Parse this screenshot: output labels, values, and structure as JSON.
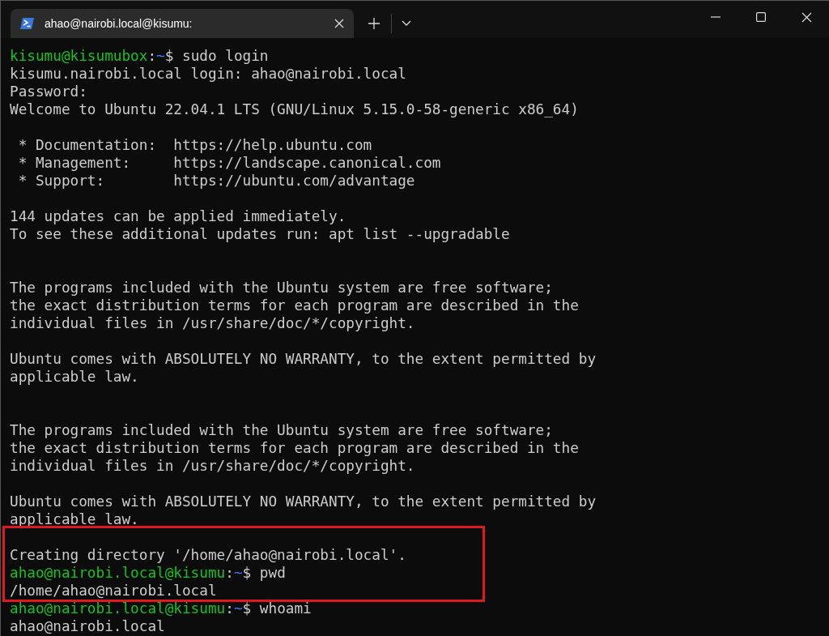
{
  "window": {
    "tab": {
      "title": "ahao@nairobi.local@kisumu:",
      "selected": true
    }
  },
  "blocks": [
    {
      "highlighted": false,
      "lines": [
        {
          "kind": "prompt",
          "user_host": "kisumu@kisumubox",
          "separator": ":",
          "path": "~",
          "command": "$ sudo login"
        },
        {
          "kind": "output",
          "text": "kisumu.nairobi.local login: ahao@nairobi.local"
        },
        {
          "kind": "output",
          "text": "Password:"
        },
        {
          "kind": "output",
          "text": "Welcome to Ubuntu 22.04.1 LTS (GNU/Linux 5.15.0-58-generic x86_64)"
        },
        {
          "kind": "blank"
        },
        {
          "kind": "output",
          "text": " * Documentation:  https://help.ubuntu.com"
        },
        {
          "kind": "output",
          "text": " * Management:     https://landscape.canonical.com"
        },
        {
          "kind": "output",
          "text": " * Support:        https://ubuntu.com/advantage"
        },
        {
          "kind": "blank"
        },
        {
          "kind": "output",
          "text": "144 updates can be applied immediately."
        },
        {
          "kind": "output",
          "text": "To see these additional updates run: apt list --upgradable"
        },
        {
          "kind": "blank"
        },
        {
          "kind": "blank"
        },
        {
          "kind": "output",
          "text": "The programs included with the Ubuntu system are free software;"
        },
        {
          "kind": "output",
          "text": "the exact distribution terms for each program are described in the"
        },
        {
          "kind": "output",
          "text": "individual files in /usr/share/doc/*/copyright."
        },
        {
          "kind": "blank"
        },
        {
          "kind": "output",
          "text": "Ubuntu comes with ABSOLUTELY NO WARRANTY, to the extent permitted by"
        },
        {
          "kind": "output",
          "text": "applicable law."
        },
        {
          "kind": "blank"
        },
        {
          "kind": "blank"
        },
        {
          "kind": "output",
          "text": "The programs included with the Ubuntu system are free software;"
        },
        {
          "kind": "output",
          "text": "the exact distribution terms for each program are described in the"
        },
        {
          "kind": "output",
          "text": "individual files in /usr/share/doc/*/copyright."
        },
        {
          "kind": "blank"
        },
        {
          "kind": "output",
          "text": "Ubuntu comes with ABSOLUTELY NO WARRANTY, to the extent permitted by"
        },
        {
          "kind": "output",
          "text": "applicable law."
        }
      ]
    },
    {
      "highlighted": true,
      "lines": [
        {
          "kind": "blank"
        },
        {
          "kind": "output",
          "text": "Creating directory '/home/ahao@nairobi.local'."
        },
        {
          "kind": "prompt",
          "user_host": "ahao@nairobi.local@kisumu",
          "separator": ":",
          "path": "~",
          "command": "$ pwd"
        },
        {
          "kind": "output",
          "text": "/home/ahao@nairobi.local"
        }
      ]
    },
    {
      "highlighted": false,
      "lines": [
        {
          "kind": "prompt",
          "user_host": "ahao@nairobi.local@kisumu",
          "separator": ":",
          "path": "~",
          "command": "$ whoami"
        },
        {
          "kind": "output",
          "text": "ahao@nairobi.local"
        }
      ]
    }
  ]
}
